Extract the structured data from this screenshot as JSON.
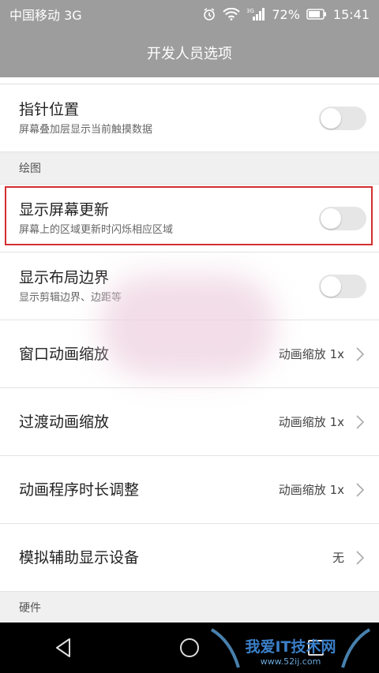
{
  "status": {
    "carrier": "中国移动 3G",
    "battery_pct": "72%",
    "time": "15:41",
    "icons": [
      "alarm-icon",
      "wifi-icon",
      "signal-3g-icon",
      "battery-icon"
    ]
  },
  "header": {
    "title": "开发人员选项"
  },
  "items": {
    "pointer": {
      "title": "指针位置",
      "sub": "屏幕叠加层显示当前触摸数据",
      "on": false
    },
    "section_drawing": "绘图",
    "surface_updates": {
      "title": "显示屏幕更新",
      "sub": "屏幕上的区域更新时闪烁相应区域",
      "on": false
    },
    "layout_bounds": {
      "title": "显示布局边界",
      "sub": "显示剪辑边界、边距等",
      "on": false
    },
    "window_anim": {
      "title": "窗口动画缩放",
      "value": "动画缩放 1x"
    },
    "transition_anim": {
      "title": "过渡动画缩放",
      "value": "动画缩放 1x"
    },
    "animator_duration": {
      "title": "动画程序时长调整",
      "value": "动画缩放 1x"
    },
    "simulate_display": {
      "title": "模拟辅助显示设备",
      "value": "无"
    },
    "section_hardware": "硬件"
  },
  "navbar": {
    "icons": [
      "back-icon",
      "home-icon",
      "recents-icon"
    ]
  },
  "watermark": {
    "text": "我爱IT技术网",
    "url": "www.52ij.com"
  },
  "colors": {
    "bar": "#9d9d9d",
    "highlight": "#d32f2f",
    "toggle_off": "#e6e6e6"
  }
}
